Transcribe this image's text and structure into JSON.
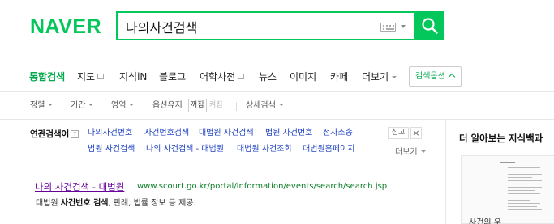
{
  "header": {
    "logo": "NAVER",
    "search": {
      "value": "나의사건검색"
    }
  },
  "tabs": [
    {
      "label": "통합검색",
      "active": true
    },
    {
      "label": "지도"
    },
    {
      "label": "지식iN"
    },
    {
      "label": "블로그"
    },
    {
      "label": "어학사전"
    },
    {
      "label": "뉴스"
    },
    {
      "label": "이미지"
    },
    {
      "label": "카페"
    },
    {
      "label": "더보기"
    }
  ],
  "search_options_label": "검색옵션",
  "options": {
    "sort": "정렬",
    "period": "기간",
    "area": "영역",
    "keep_option": "옵션유지",
    "on": "꺼짐",
    "off": "켜짐",
    "detail": "상세검색"
  },
  "related": {
    "title": "연관검색어",
    "help": "?",
    "row1": [
      "나의사건번호",
      "사건번호검색",
      "대법원 사건검색",
      "법원 사건번호",
      "전자소송"
    ],
    "row2": [
      "법원 사건검색",
      "나의 사건검색 - 대법원",
      "대법원 사건조회",
      "대법원홈페이지"
    ],
    "report": "신고",
    "close": "×",
    "more": "더보기"
  },
  "result": {
    "title": "나의 사건검색 - 대법원",
    "url": "www.scourt.go.kr/portal/information/events/search/search.jsp",
    "desc_prefix": "대법원 ",
    "desc_bold": "사건번호 검색",
    "desc_suffix": ", 판례, 법률 정보 등 제공."
  },
  "side": {
    "title": "더 알아보는 지식백과",
    "caption": "사건의 우"
  },
  "colors": {
    "brand": "#03c75a",
    "link": "#1a3ec1",
    "visited": "#660099",
    "url": "#0c7e26"
  }
}
